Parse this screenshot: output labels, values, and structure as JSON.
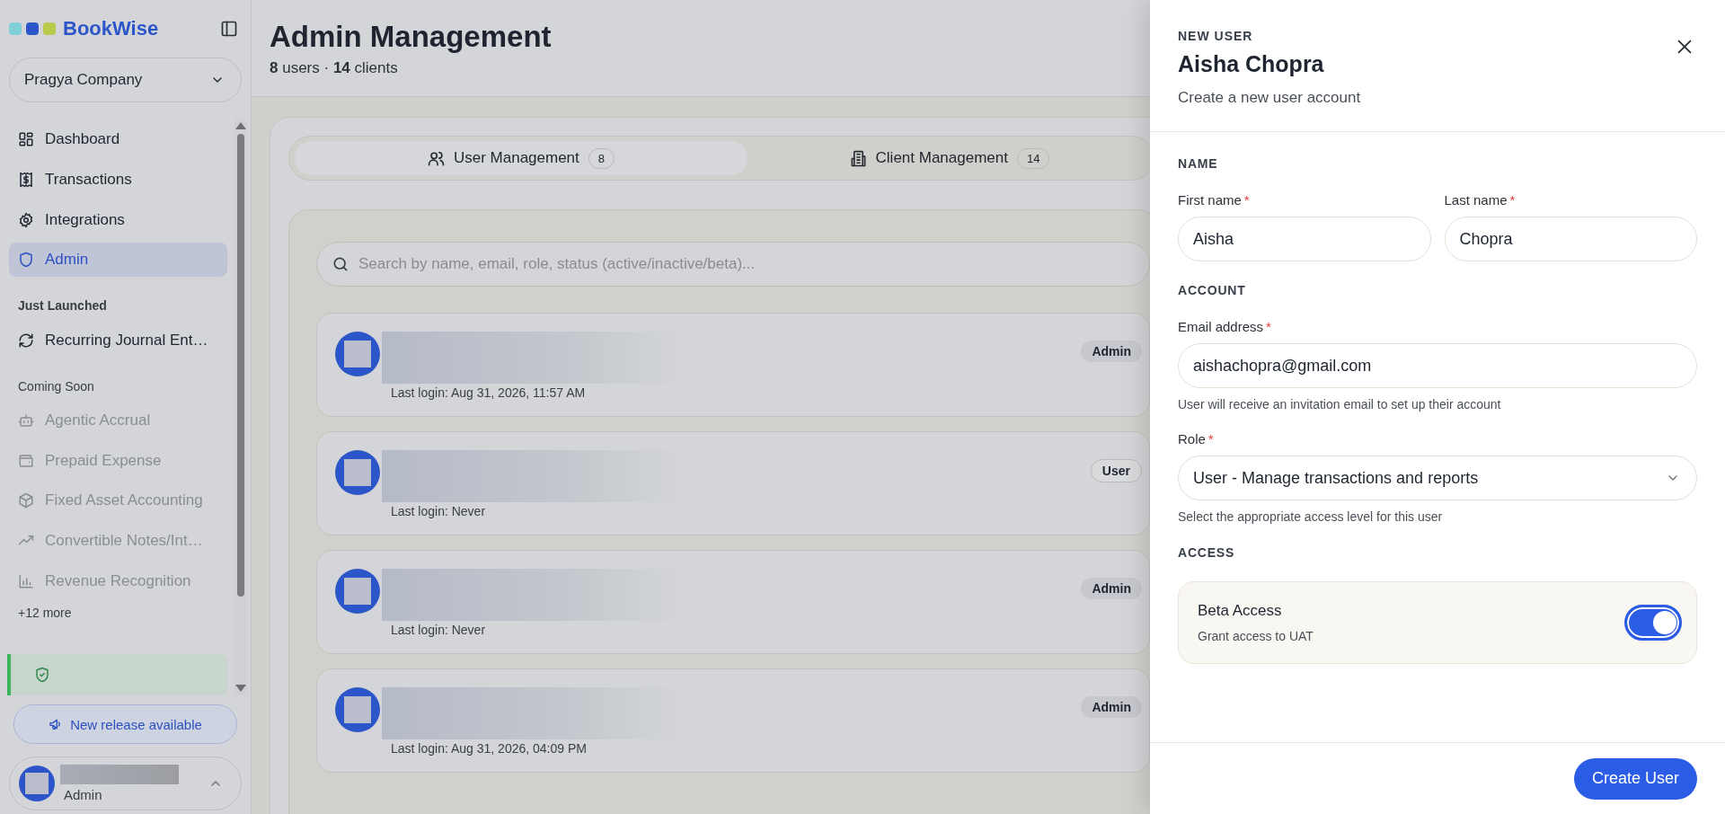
{
  "sidebar": {
    "brand": "BookWise",
    "company_selector": {
      "value": "Pragya Company"
    },
    "nav_items": [
      {
        "label": "Dashboard",
        "selected": false
      },
      {
        "label": "Transactions",
        "selected": false
      },
      {
        "label": "Integrations",
        "selected": false
      },
      {
        "label": "Admin",
        "selected": true
      }
    ],
    "sections": [
      {
        "heading": "Just Launched",
        "emphasized": true,
        "items": [
          {
            "label": "Recurring Journal Ent…",
            "disabled": false
          }
        ]
      },
      {
        "heading": "Coming Soon",
        "emphasized": false,
        "items": [
          {
            "label": "Agentic Accrual",
            "disabled": true
          },
          {
            "label": "Prepaid Expense",
            "disabled": true
          },
          {
            "label": "Fixed Asset Accounting",
            "disabled": true
          },
          {
            "label": "Convertible Notes/Int…",
            "disabled": true
          },
          {
            "label": "Revenue Recognition",
            "disabled": true
          }
        ]
      }
    ],
    "more_link": "+12 more",
    "release_button": "New release available",
    "user": {
      "role": "Admin"
    }
  },
  "header": {
    "title": "Admin Management",
    "summary": "**8** users · **14** clients"
  },
  "tabs": [
    {
      "label": "User Management",
      "count": "8",
      "selected": true
    },
    {
      "label": "Client Management",
      "count": "14",
      "selected": false
    }
  ],
  "search": {
    "placeholder": "Search by name, email, role, status (active/inactive/beta)..."
  },
  "users": [
    {
      "last_login": "Last login: Aug 31, 2026, 11:57 AM",
      "role": "Admin",
      "kind": "admin"
    },
    {
      "last_login": "Last login: Never",
      "role": "User",
      "kind": "user"
    },
    {
      "last_login": "Last login: Never",
      "role": "Admin",
      "kind": "admin"
    },
    {
      "last_login": "Last login: Aug 31, 2026, 04:09 PM",
      "role": "Admin",
      "kind": "admin"
    }
  ],
  "drawer": {
    "eyebrow": "NEW USER",
    "title": "Aisha Chopra",
    "subtitle": "Create a new user account",
    "sections": [
      {
        "heading": "NAME",
        "fields": [
          {
            "kind": "text",
            "label": "First name",
            "required_mark": "*",
            "value": "Aisha"
          },
          {
            "kind": "text",
            "label": "Last name",
            "required_mark": "*",
            "value": "Chopra"
          }
        ]
      },
      {
        "heading": "ACCOUNT",
        "fields": [
          {
            "kind": "text",
            "label": "Email address",
            "required_mark": "*",
            "value": "aishachopra@gmail.com",
            "help": "User will receive an invitation email to set up their account"
          },
          {
            "kind": "select",
            "label": "Role",
            "required_mark": "*",
            "value": "User - Manage transactions and reports",
            "help": "Select the appropriate access level for this user"
          }
        ]
      },
      {
        "heading": "ACCESS",
        "fields": [
          {
            "kind": "toggle",
            "label": "Beta Access",
            "description": "Grant access to UAT",
            "on": true
          }
        ]
      }
    ],
    "submit_button": "Create User"
  }
}
